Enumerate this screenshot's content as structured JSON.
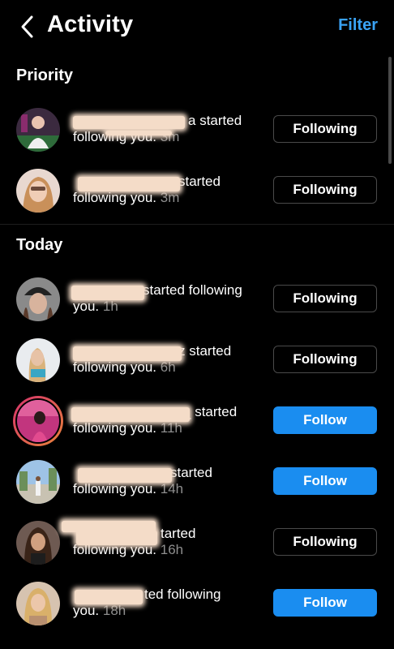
{
  "header": {
    "title": "Activity",
    "filter_label": "Filter"
  },
  "sections": {
    "priority": "Priority",
    "today": "Today"
  },
  "rows": [
    {
      "name_suffix": "a",
      "action": "started",
      "line2": "following you.",
      "time": "3m",
      "button": "Following"
    },
    {
      "name_suffix": "",
      "action": "started",
      "line2": "following you.",
      "time": "3m",
      "button": "Following"
    },
    {
      "name_suffix": "",
      "action": "started following",
      "line2": "you.",
      "time": "1h",
      "button": "Following"
    },
    {
      "name_suffix": "z",
      "action": "started",
      "line2": "following you.",
      "time": "6h",
      "button": "Following"
    },
    {
      "name_suffix": "_",
      "action": "started",
      "line2": "following you.",
      "time": "11h",
      "button": "Follow"
    },
    {
      "name_suffix": "",
      "action": "started",
      "line2": "following you.",
      "time": "14h",
      "button": "Follow"
    },
    {
      "name_suffix": "",
      "action": "tarted",
      "line2": "following you.",
      "time": "16h",
      "button": "Following"
    },
    {
      "name_suffix": "",
      "action": "ted following",
      "line2": "you.",
      "time": "18h",
      "button": "Follow"
    }
  ],
  "colors": {
    "accent": "#3aa3f5",
    "follow_button": "#1a8df0",
    "time_text": "#8e8e8e"
  },
  "icons": {
    "back": "chevron-left-icon"
  }
}
